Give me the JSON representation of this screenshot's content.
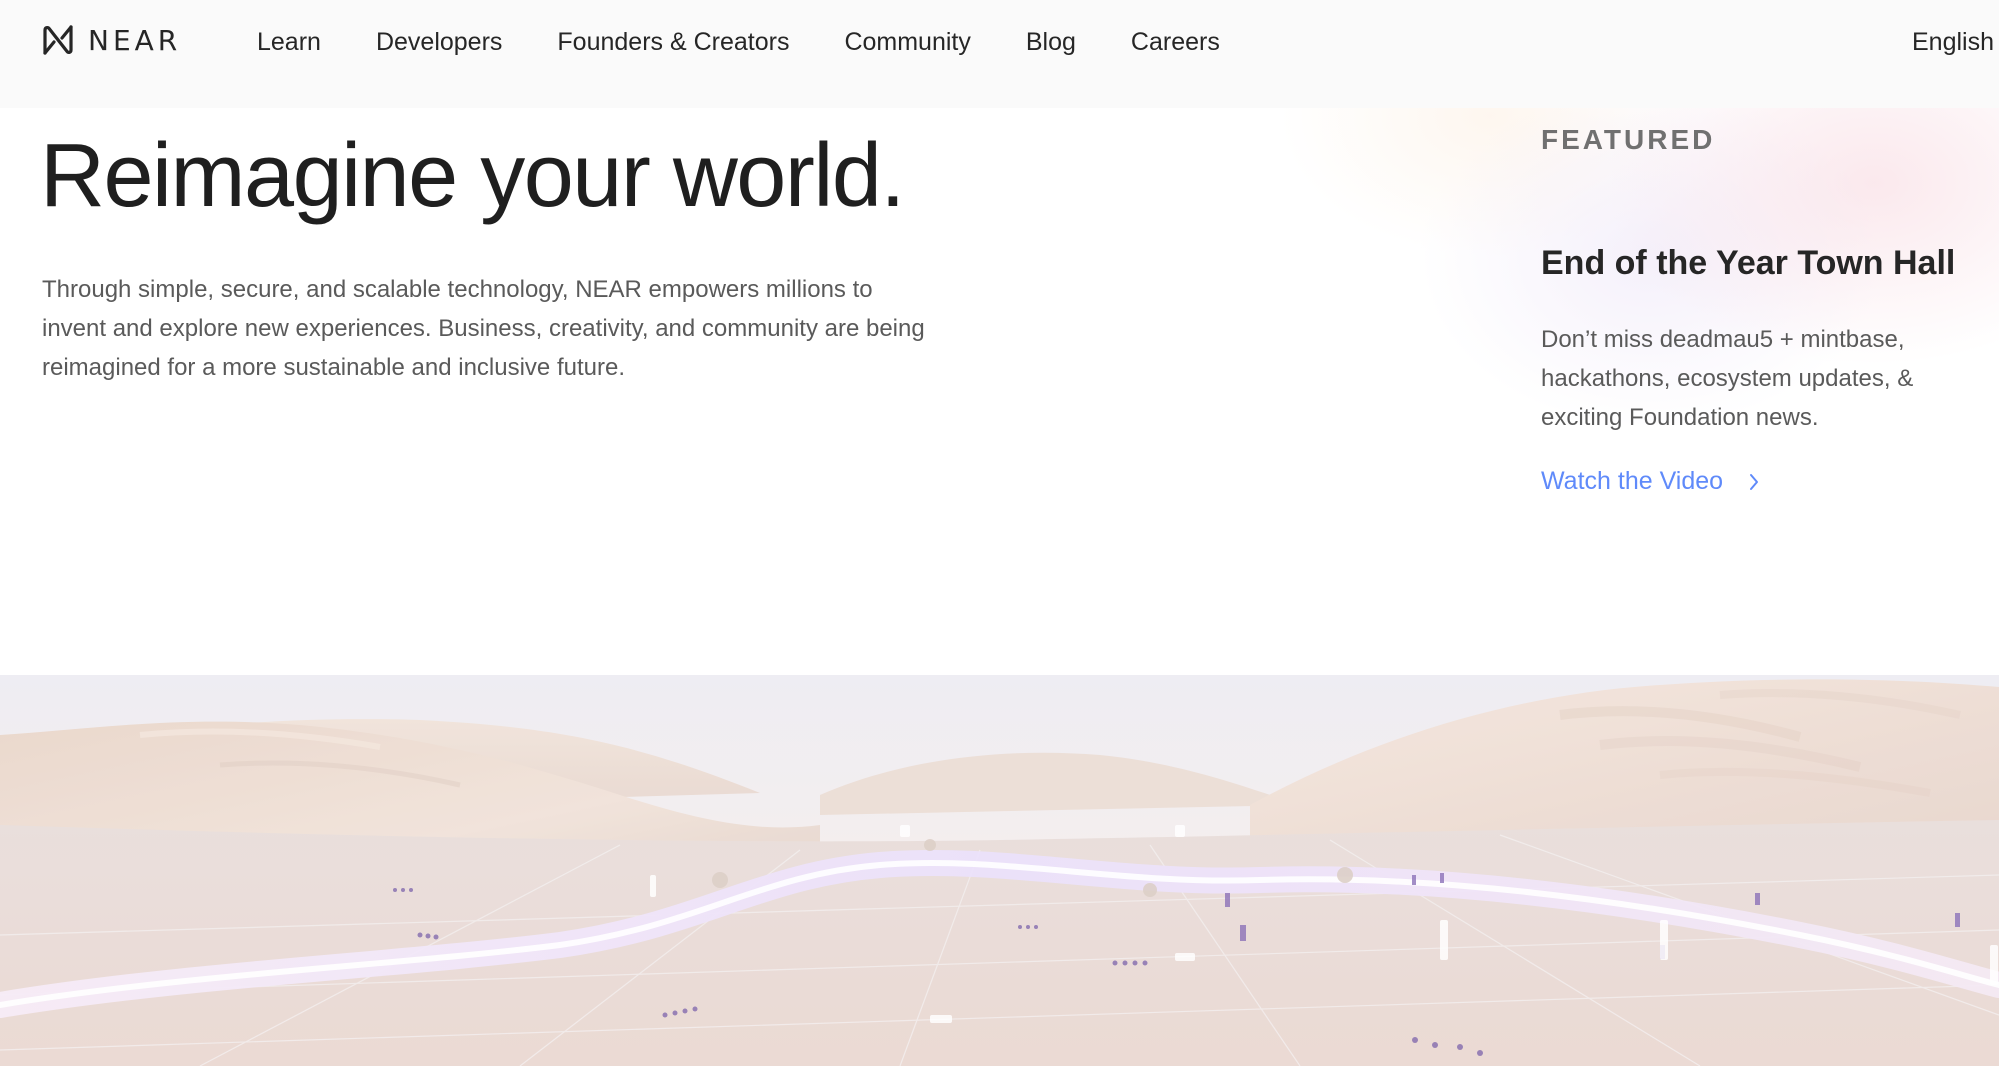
{
  "brand": {
    "name": "NEAR"
  },
  "nav": {
    "items": [
      {
        "label": "Learn"
      },
      {
        "label": "Developers"
      },
      {
        "label": "Founders & Creators"
      },
      {
        "label": "Community"
      },
      {
        "label": "Blog"
      },
      {
        "label": "Careers"
      }
    ],
    "language": "English"
  },
  "hero": {
    "title": "Reimagine your world.",
    "description": "Through simple, secure, and scalable technology, NEAR empowers millions to invent and explore new experiences. Business, creativity, and community are being reimagined for a more sustainable and inclusive future."
  },
  "featured": {
    "label": "FEATURED",
    "title": "End of the Year Town Hall",
    "description": "Don’t miss deadmau5 + mintbase, hackathons, ecosystem updates, & exciting Foundation news.",
    "cta": "Watch the Video"
  },
  "colors": {
    "text": "#262626",
    "muted": "#5a5a5a",
    "link": "#5f8afa",
    "nav_bg": "#fafafa"
  }
}
